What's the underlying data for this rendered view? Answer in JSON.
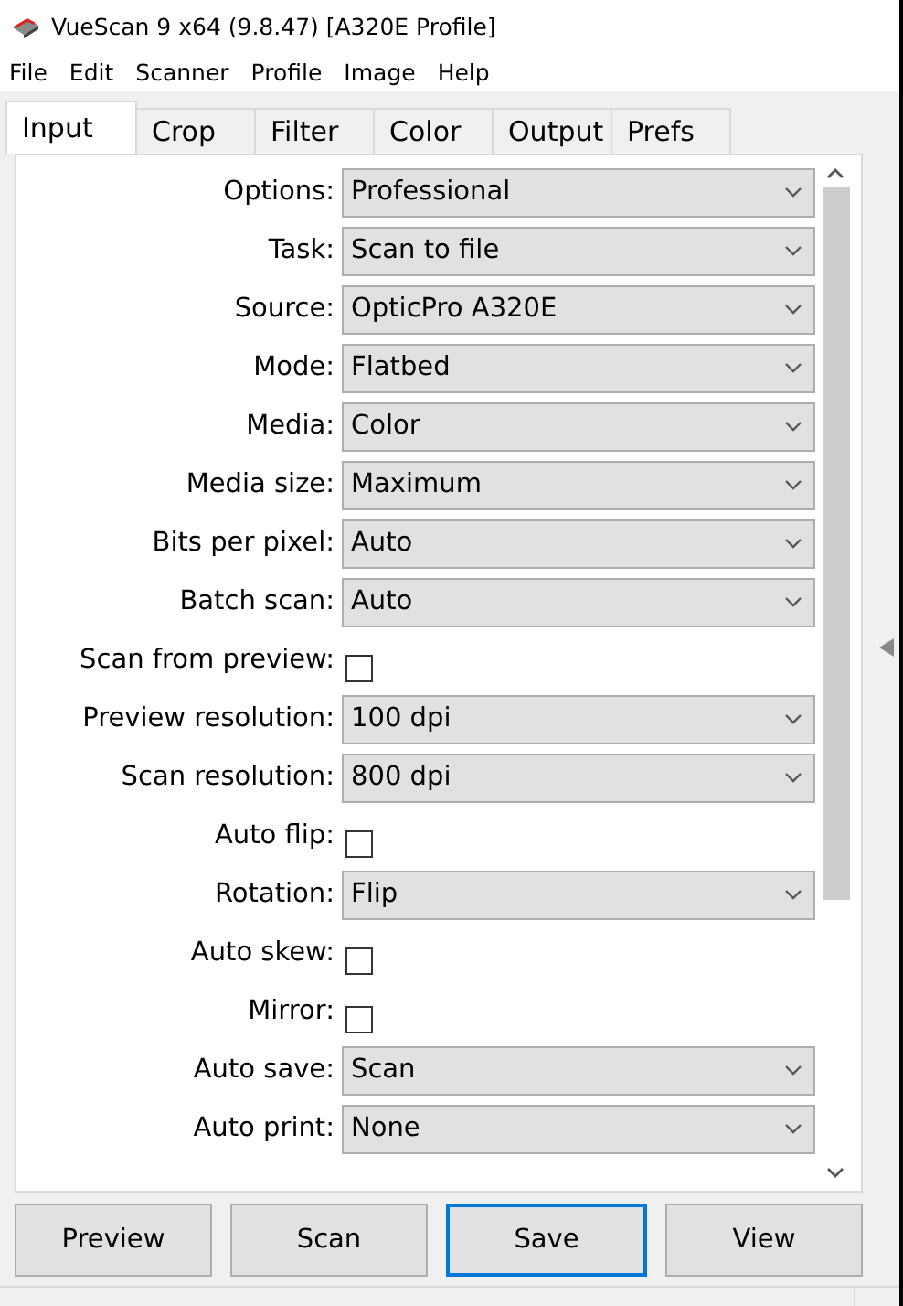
{
  "window": {
    "title": "VueScan 9 x64 (9.8.47) [A320E Profile]"
  },
  "menu": [
    "File",
    "Edit",
    "Scanner",
    "Profile",
    "Image",
    "Help"
  ],
  "tabs": [
    {
      "label": "Input",
      "selected": true
    },
    {
      "label": "Crop",
      "selected": false
    },
    {
      "label": "Filter",
      "selected": false
    },
    {
      "label": "Color",
      "selected": false
    },
    {
      "label": "Output",
      "selected": false
    },
    {
      "label": "Prefs",
      "selected": false
    }
  ],
  "settings": [
    {
      "kind": "select",
      "label": "Options:",
      "value": "Professional"
    },
    {
      "kind": "select",
      "label": "Task:",
      "value": "Scan to file"
    },
    {
      "kind": "select",
      "label": "Source:",
      "value": "OpticPro A320E"
    },
    {
      "kind": "select",
      "label": "Mode:",
      "value": "Flatbed"
    },
    {
      "kind": "select",
      "label": "Media:",
      "value": "Color"
    },
    {
      "kind": "select",
      "label": "Media size:",
      "value": "Maximum"
    },
    {
      "kind": "select",
      "label": "Bits per pixel:",
      "value": "Auto"
    },
    {
      "kind": "select",
      "label": "Batch scan:",
      "value": "Auto"
    },
    {
      "kind": "checkbox",
      "label": "Scan from preview:",
      "checked": false
    },
    {
      "kind": "select",
      "label": "Preview resolution:",
      "value": "100 dpi"
    },
    {
      "kind": "select",
      "label": "Scan resolution:",
      "value": "800 dpi"
    },
    {
      "kind": "checkbox",
      "label": "Auto flip:",
      "checked": false
    },
    {
      "kind": "select",
      "label": "Rotation:",
      "value": "Flip"
    },
    {
      "kind": "checkbox",
      "label": "Auto skew:",
      "checked": false
    },
    {
      "kind": "checkbox",
      "label": "Mirror:",
      "checked": false
    },
    {
      "kind": "select",
      "label": "Auto save:",
      "value": "Scan"
    },
    {
      "kind": "select",
      "label": "Auto print:",
      "value": "None"
    }
  ],
  "buttons": [
    {
      "label": "Preview",
      "selected": false
    },
    {
      "label": "Scan",
      "selected": false
    },
    {
      "label": "Save",
      "selected": true
    },
    {
      "label": "View",
      "selected": false
    }
  ]
}
